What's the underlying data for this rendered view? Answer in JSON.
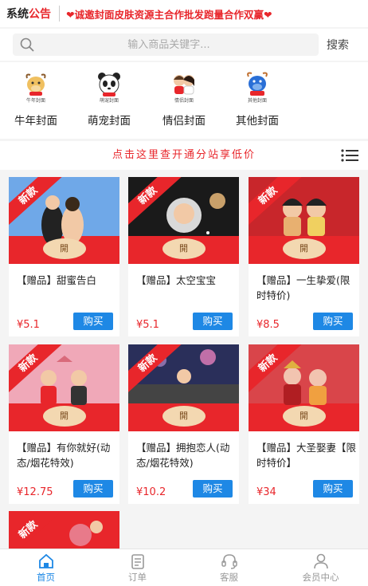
{
  "notice": {
    "tag_prefix": "系统",
    "tag_highlight": "公告",
    "message": "❤诚邀封面皮肤资源主合作批发跑量合作双赢❤"
  },
  "search": {
    "placeholder": "输入商品关键字...",
    "button_label": "搜索"
  },
  "categories": [
    {
      "small": "牛年封面",
      "label": "牛年封面",
      "icon": "ox-icon"
    },
    {
      "small": "萌宠封面",
      "label": "萌宠封面",
      "icon": "panda-icon"
    },
    {
      "small": "情侣封面",
      "label": "情侣封面",
      "icon": "couple-icon"
    },
    {
      "small": "其他封面",
      "label": "其他封面",
      "icon": "other-icon"
    }
  ],
  "promo": {
    "text": "点击这里查开通分站享低价"
  },
  "product_ribbon": "新款",
  "seal_text": "開",
  "buy_label": "购买",
  "products": [
    {
      "title": "【赠品】甜蜜告白",
      "price": "¥5.1",
      "colors": [
        "#6fa8e8",
        "#e9c9a8"
      ]
    },
    {
      "title": "【赠品】太空宝宝",
      "price": "¥5.1",
      "colors": [
        "#1a1a1a",
        "#bbbbbb"
      ]
    },
    {
      "title": "【赠品】一生挚爱(限时特价)",
      "price": "¥8.5",
      "colors": [
        "#c8262b",
        "#e8b070"
      ]
    },
    {
      "title": "【赠品】有你就好(动态/烟花特效)",
      "price": "¥12.75",
      "colors": [
        "#f0a8b8",
        "#d96a7a"
      ]
    },
    {
      "title": "【赠品】拥抱恋人(动态/烟花特效)",
      "price": "¥10.2",
      "colors": [
        "#2a2f5a",
        "#8a6fa8"
      ]
    },
    {
      "title": "【赠品】大圣娶妻【限时特价】",
      "price": "¥34",
      "colors": [
        "#d9454a",
        "#f2c4b0"
      ]
    },
    {
      "title": "",
      "price": "",
      "colors": [
        "#e8262b",
        "#e87a8a"
      ]
    }
  ],
  "tabs": [
    {
      "label": "首页",
      "icon": "home-icon",
      "active": true
    },
    {
      "label": "订单",
      "icon": "order-icon",
      "active": false
    },
    {
      "label": "客服",
      "icon": "headset-icon",
      "active": false
    },
    {
      "label": "会员中心",
      "icon": "user-icon",
      "active": false
    }
  ],
  "colors": {
    "accent": "#e8262b",
    "primary": "#1e88e5"
  }
}
